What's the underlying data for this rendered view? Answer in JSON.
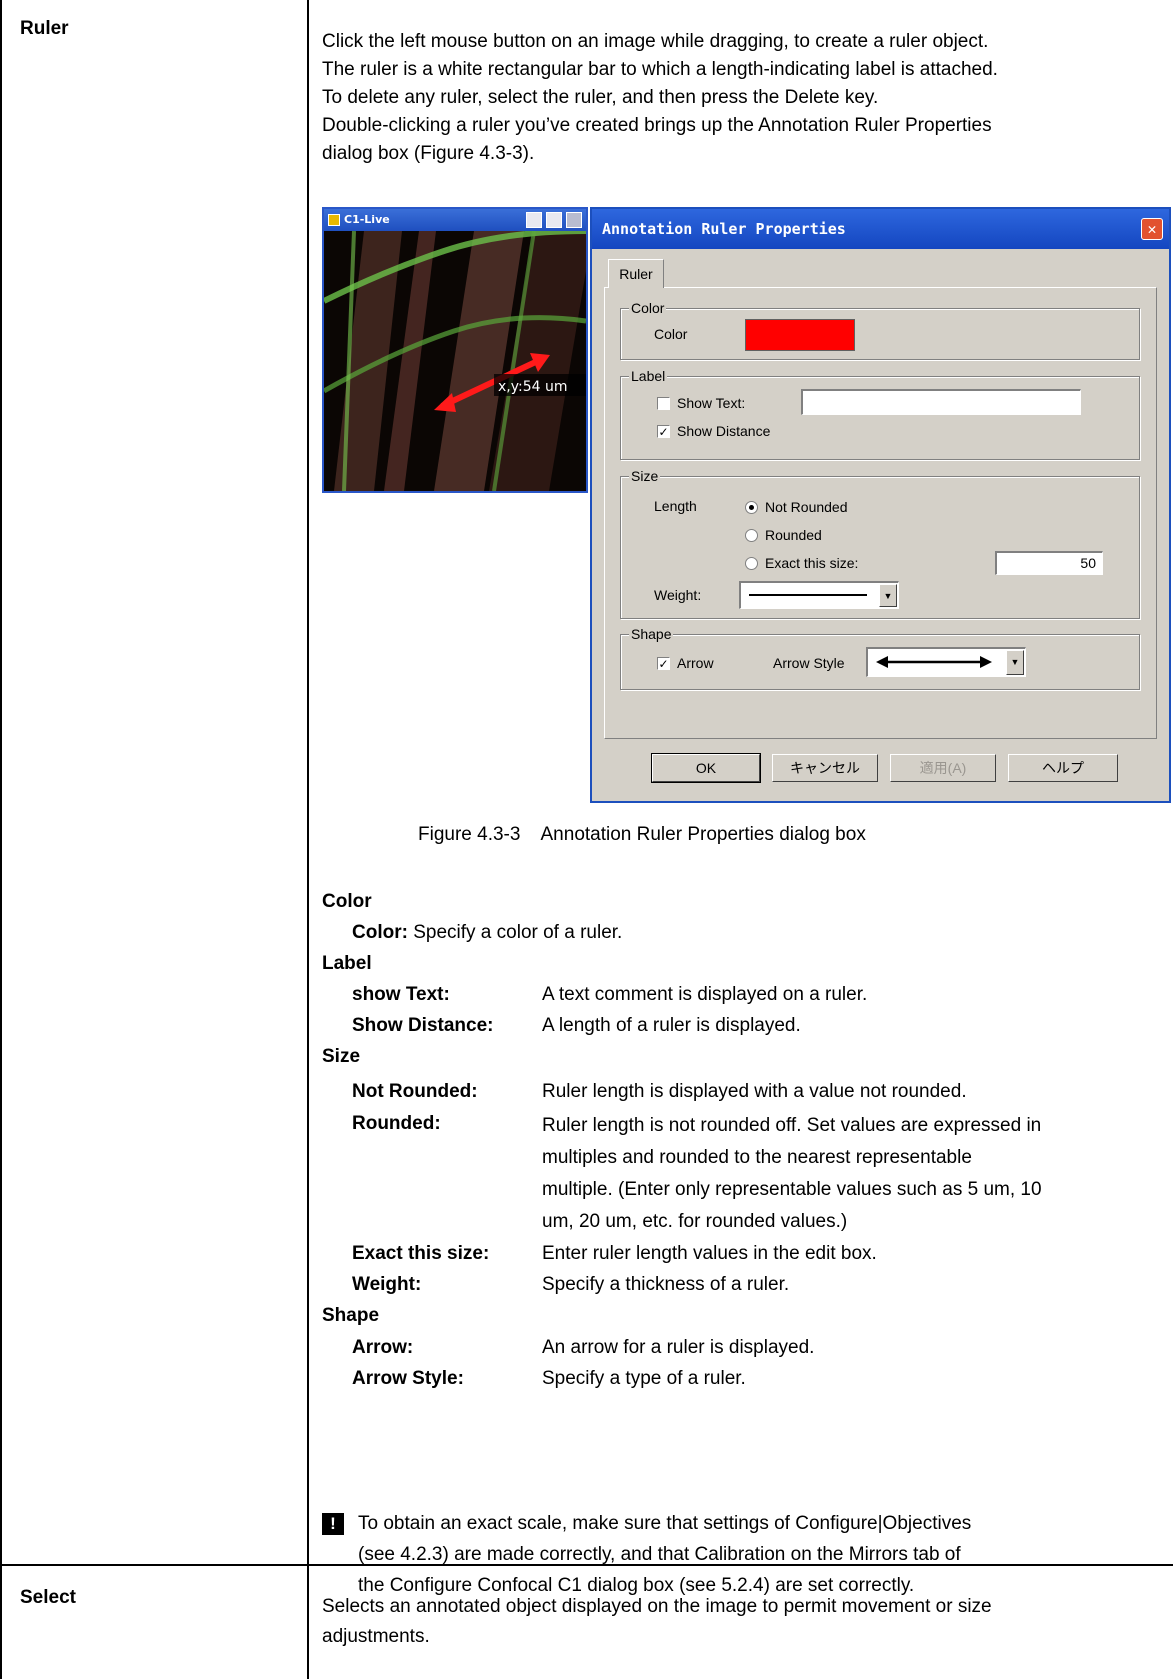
{
  "rows": [
    {
      "label": "Ruler",
      "intro": [
        "Click the left mouse button on an image while dragging, to create a ruler object.",
        "The ruler is a white rectangular bar to which a length-indicating label is attached.",
        "To delete any ruler, select the ruler, and then press the Delete key.",
        "Double-clicking a ruler you’ve created brings up the Annotation Ruler Properties",
        "dialog box (Figure 4.3-3)."
      ]
    },
    {
      "label": "Select",
      "text": [
        "Selects an annotated object displayed on the image to permit movement or size",
        "adjustments."
      ]
    }
  ],
  "live_window": {
    "title": "C1-Live",
    "ruler_label": "x,y:54 um"
  },
  "dialog": {
    "title": "Annotation Ruler Properties",
    "close": "✕",
    "tab": "Ruler",
    "color_group": "Color",
    "color_label": "Color",
    "color_value": "#ff0000",
    "label_group": "Label",
    "show_text": "Show Text:",
    "show_text_checked": false,
    "show_text_value": "",
    "show_distance": "Show Distance",
    "show_distance_checked": true,
    "size_group": "Size",
    "length_label": "Length",
    "not_rounded": "Not Rounded",
    "rounded": "Rounded",
    "exact": "Exact this size:",
    "exact_value": "50",
    "selected_length": "Not Rounded",
    "weight_label": "Weight:",
    "shape_group": "Shape",
    "arrow": "Arrow",
    "arrow_checked": true,
    "arrow_style_label": "Arrow Style",
    "ok": "OK",
    "cancel": "キャンセル",
    "apply": "適用(A)",
    "help": "ヘルプ"
  },
  "figure_caption": "Figure 4.3-3    Annotation Ruler Properties dialog box",
  "descriptions": {
    "color_heading": "Color",
    "color_term": "Color:",
    "color_desc": "Specify a color of a ruler.",
    "label_heading": "Label",
    "show_text_term": "show Text:",
    "show_text_desc": "A text comment is displayed on a ruler.",
    "show_distance_term": "Show Distance:",
    "show_distance_desc": "A length of a ruler is displayed.",
    "size_heading": "Size",
    "not_rounded_term": "Not Rounded:",
    "not_rounded_desc": "Ruler length is displayed with a value not rounded.",
    "rounded_term": "Rounded:",
    "rounded_desc": [
      "Ruler length is not rounded off. Set values are expressed in",
      "multiples and rounded to the nearest representable",
      "multiple. (Enter only representable values such as 5 um, 10",
      "um, 20 um, etc. for rounded values.)"
    ],
    "exact_term": "Exact this size:",
    "exact_desc": "Enter ruler length values in the edit box.",
    "weight_term": "Weight:",
    "weight_desc": "Specify a thickness of a ruler.",
    "shape_heading": "Shape",
    "arrow_term": "Arrow:",
    "arrow_desc": "An arrow for a ruler is displayed.",
    "arrow_style_term": "Arrow Style:",
    "arrow_style_desc": "Specify a type of a ruler."
  },
  "note": {
    "icon": "!",
    "lines": [
      "To obtain an exact scale, make sure that settings of Configure|Objectives",
      "(see 4.2.3) are made correctly, and that Calibration on the Mirrors tab of",
      "the Configure Confocal C1 dialog box (see 5.2.4) are set correctly."
    ]
  }
}
